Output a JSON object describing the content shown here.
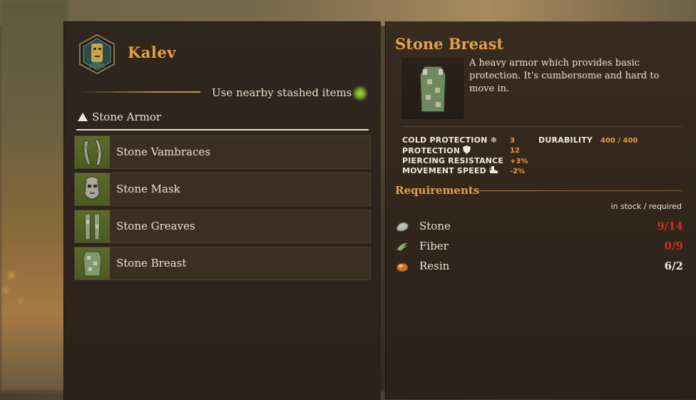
{
  "character": {
    "name": "Kalev"
  },
  "stash": {
    "label": "Use nearby stashed items"
  },
  "category": {
    "label": "Stone Armor"
  },
  "items": [
    {
      "label": "Stone Vambraces"
    },
    {
      "label": "Stone Mask"
    },
    {
      "label": "Stone Greaves"
    },
    {
      "label": "Stone Breast"
    }
  ],
  "detail": {
    "title": "Stone Breast",
    "description": "A heavy armor which provides basic protection. It's cumbersome and hard to move in.",
    "stats": [
      {
        "label": "COLD PROTECTION",
        "icon": "snowflake-icon",
        "value": "3"
      },
      {
        "label": "PROTECTION",
        "icon": "shield-icon",
        "value": "12"
      },
      {
        "label": "PIERCING RESISTANCE",
        "icon": "",
        "value": "+3%"
      },
      {
        "label": "MOVEMENT SPEED",
        "icon": "boot-icon",
        "value": "-2%"
      }
    ],
    "durability": {
      "label": "DURABILITY",
      "value": "400 / 400"
    }
  },
  "requirements": {
    "title": "Requirements",
    "stock_header": "in stock / required",
    "resources": [
      {
        "name": "Stone",
        "count": "9/14",
        "color": "#c8322a"
      },
      {
        "name": "Fiber",
        "count": "0/9",
        "color": "#c8322a"
      },
      {
        "name": "Resin",
        "count": "6/2",
        "color": "#f4ecdd"
      }
    ]
  },
  "colors": {
    "accent": "#e3a04a",
    "insufficient": "#c8322a",
    "toggle": "#8fc23a"
  }
}
